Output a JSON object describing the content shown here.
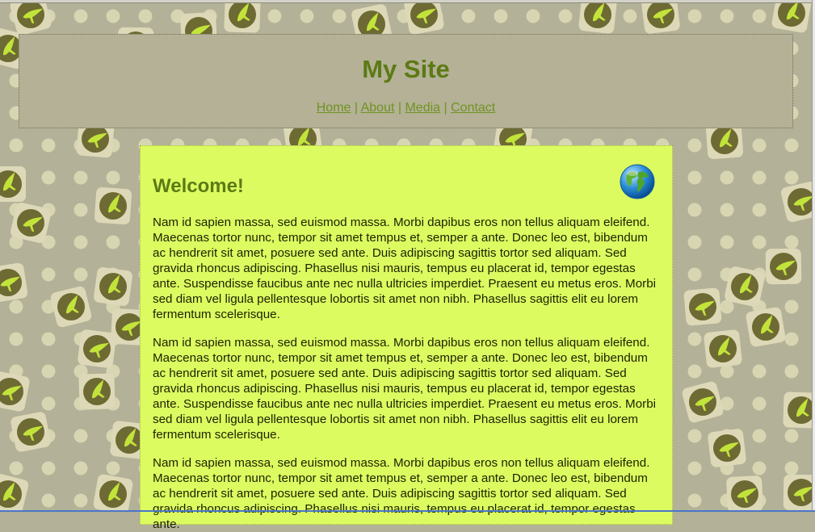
{
  "site": {
    "title": "My Site"
  },
  "nav": {
    "items": [
      {
        "label": "Home"
      },
      {
        "label": "About"
      },
      {
        "label": "Media"
      },
      {
        "label": "Contact"
      }
    ],
    "separator": "|"
  },
  "content": {
    "heading": "Welcome!",
    "globe_icon": "globe-icon",
    "paragraphs": [
      "Nam id sapien massa, sed euismod massa. Morbi dapibus eros non tellus aliquam eleifend. Maecenas tortor nunc, tempor sit amet tempus et, semper a ante. Donec leo est, bibendum ac hendrerit sit amet, posuere sed ante. Duis adipiscing sagittis tortor sed aliquam. Sed gravida rhoncus adipiscing. Phasellus nisi mauris, tempus eu placerat id, tempor egestas ante. Suspendisse faucibus ante nec nulla ultricies imperdiet. Praesent eu metus eros. Morbi sed diam vel ligula pellentesque lobortis sit amet non nibh. Phasellus sagittis elit eu lorem fermentum scelerisque.",
      "Nam id sapien massa, sed euismod massa. Morbi dapibus eros non tellus aliquam eleifend. Maecenas tortor nunc, tempor sit amet tempus et, semper a ante. Donec leo est, bibendum ac hendrerit sit amet, posuere sed ante. Duis adipiscing sagittis tortor sed aliquam. Sed gravida rhoncus adipiscing. Phasellus nisi mauris, tempus eu placerat id, tempor egestas ante. Suspendisse faucibus ante nec nulla ultricies imperdiet. Praesent eu metus eros. Morbi sed diam vel ligula pellentesque lobortis sit amet non nibh. Phasellus sagittis elit eu lorem fermentum scelerisque.",
      "Nam id sapien massa, sed euismod massa. Morbi dapibus eros non tellus aliquam eleifend. Maecenas tortor nunc, tempor sit amet tempus et, semper a ante. Donec leo est, bibendum ac hendrerit sit amet, posuere sed ante. Duis adipiscing sagittis tortor sed aliquam. Sed gravida rhoncus adipiscing. Phasellus nisi mauris, tempus eu placerat id, tempor egestas ante."
    ]
  },
  "colors": {
    "background": "#b3b197",
    "header_bg": "#b4b196",
    "content_bg": "#dcfb61",
    "accent": "#5c7a14",
    "link": "#6f9322"
  }
}
